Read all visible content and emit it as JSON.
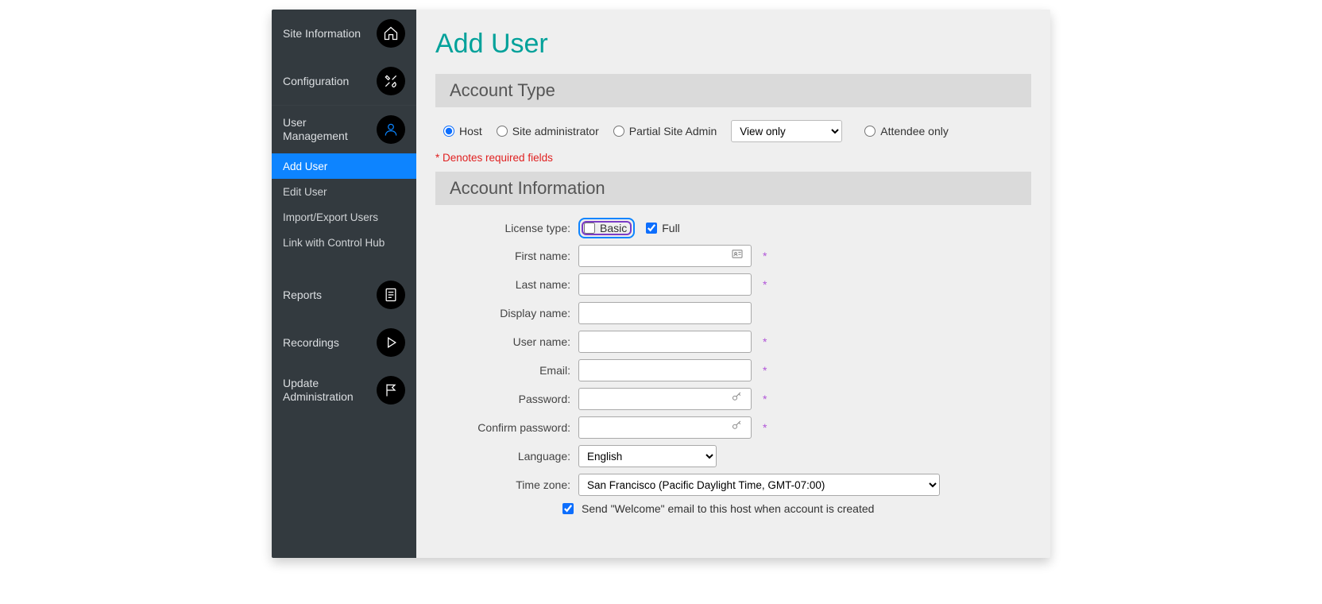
{
  "sidebar": {
    "site_information": "Site Information",
    "configuration": "Configuration",
    "user_management": "User Management",
    "add_user": "Add User",
    "edit_user": "Edit User",
    "import_export_users": "Import/Export Users",
    "link_with_control_hub": "Link with Control Hub",
    "reports": "Reports",
    "recordings": "Recordings",
    "update_administration": "Update Administration"
  },
  "page": {
    "title": "Add User",
    "required_note": "* Denotes required fields"
  },
  "section_headers": {
    "account_type": "Account Type",
    "account_information": "Account Information"
  },
  "account_type": {
    "host": "Host",
    "site_admin": "Site administrator",
    "partial_site_admin": "Partial Site Admin",
    "partial_select": "View only",
    "attendee_only": "Attendee only"
  },
  "labels": {
    "license_type": "License type:",
    "first_name": "First name:",
    "last_name": "Last name:",
    "display_name": "Display name:",
    "user_name": "User name:",
    "email": "Email:",
    "password": "Password:",
    "confirm_password": "Confirm password:",
    "language": "Language:",
    "time_zone": "Time zone:"
  },
  "license": {
    "basic": "Basic",
    "full": "Full"
  },
  "values": {
    "language": "English",
    "timezone": "San Francisco (Pacific Daylight Time, GMT-07:00)"
  },
  "welcome_email": "Send \"Welcome\" email to this host when account is created"
}
